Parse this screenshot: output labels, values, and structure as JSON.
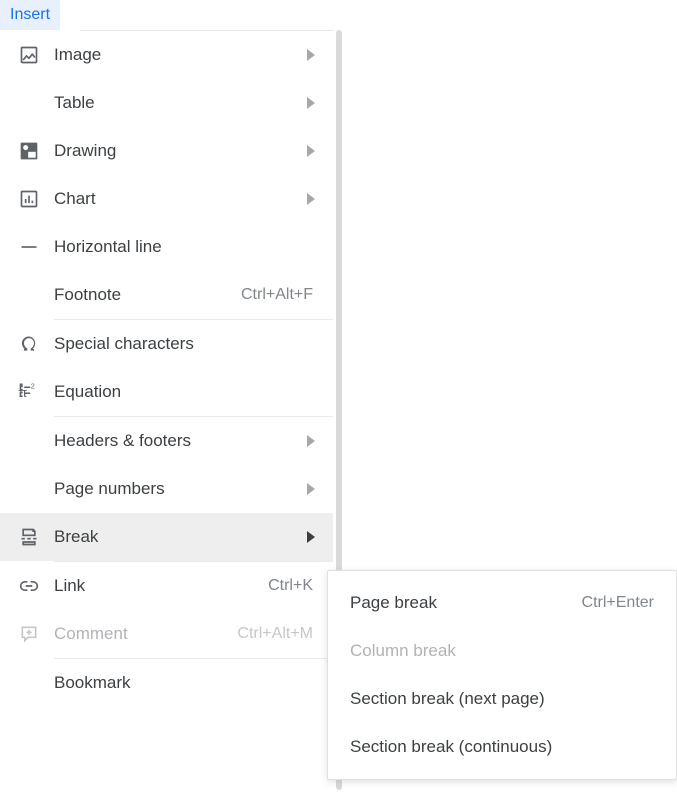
{
  "menu_tab": "Insert",
  "items": {
    "image": {
      "label": "Image"
    },
    "table": {
      "label": "Table"
    },
    "drawing": {
      "label": "Drawing"
    },
    "chart": {
      "label": "Chart"
    },
    "horizontal_line": {
      "label": "Horizontal line"
    },
    "footnote": {
      "label": "Footnote",
      "shortcut": "Ctrl+Alt+F"
    },
    "special_characters": {
      "label": "Special characters"
    },
    "equation": {
      "label": "Equation"
    },
    "headers_footers": {
      "label": "Headers & footers"
    },
    "page_numbers": {
      "label": "Page numbers"
    },
    "break": {
      "label": "Break"
    },
    "link": {
      "label": "Link",
      "shortcut": "Ctrl+K"
    },
    "comment": {
      "label": "Comment",
      "shortcut": "Ctrl+Alt+M"
    },
    "bookmark": {
      "label": "Bookmark"
    }
  },
  "submenu": {
    "page_break": {
      "label": "Page break",
      "shortcut": "Ctrl+Enter"
    },
    "column_break": {
      "label": "Column break"
    },
    "section_next": {
      "label": "Section break (next page)"
    },
    "section_cont": {
      "label": "Section break (continuous)"
    }
  }
}
